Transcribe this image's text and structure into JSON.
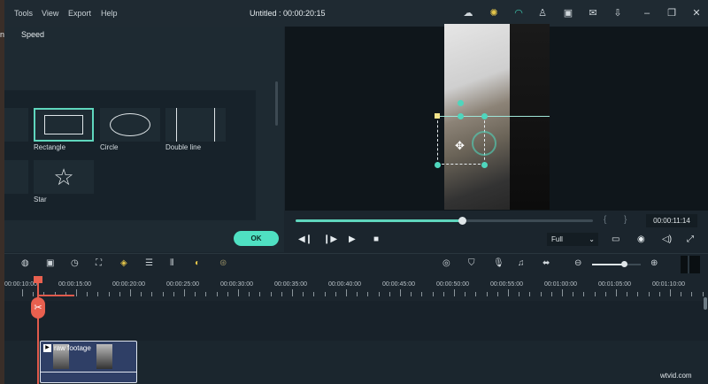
{
  "menu": {
    "items": [
      "Tools",
      "View",
      "Export",
      "Help"
    ]
  },
  "title": "Untitled : 00:00:20:15",
  "top_icons": [
    "cloud-icon",
    "bulb-icon",
    "headset-icon",
    "account-icon",
    "save-icon",
    "mail-icon",
    "download-icon",
    "minimize-icon",
    "restore-icon",
    "close-icon"
  ],
  "panel": {
    "tabs": [
      "n",
      "Speed"
    ],
    "shapes": [
      "Rectangle",
      "Circle",
      "Double line",
      "Star"
    ],
    "selected": "Rectangle",
    "ok_label": "OK"
  },
  "player": {
    "progress": 0.56,
    "timecode": "00:00:11:14",
    "zoom": "Full",
    "mark_in": "{",
    "mark_out": "}"
  },
  "timeline": {
    "ruler": [
      "00:00:10:00",
      "00:00:15:00",
      "00:00:20:00",
      "00:00:25:00",
      "00:00:30:00",
      "00:00:35:00",
      "00:00:40:00",
      "00:00:45:00",
      "00:00:50:00",
      "00:00:55:00",
      "00:01:00:00",
      "00:01:05:00",
      "00:01:10:00"
    ],
    "clip_name": "raw footage"
  },
  "colors": {
    "accent": "#4fe0c2",
    "playhead": "#e05a4c",
    "clip": "#2f3f66"
  },
  "watermark": "wtvid.com"
}
